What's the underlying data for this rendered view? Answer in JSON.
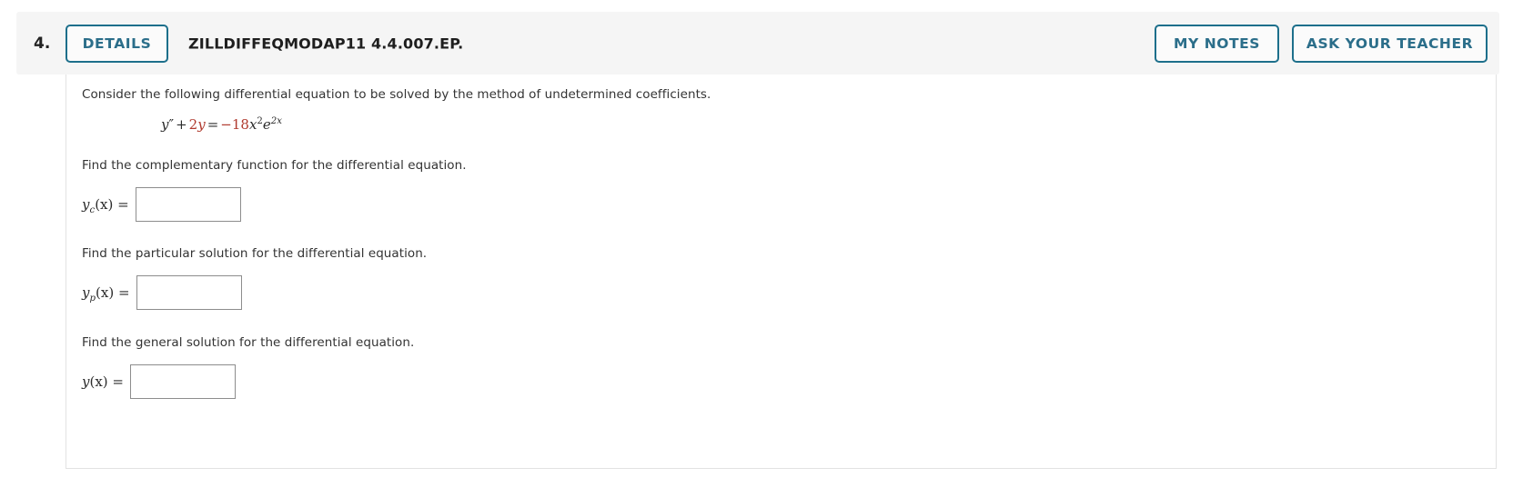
{
  "header": {
    "question_number": "4.",
    "details_label": "DETAILS",
    "assignment_id": "ZILLDIFFEQMODAP11 4.4.007.EP.",
    "my_notes_label": "MY NOTES",
    "ask_teacher_label": "ASK YOUR TEACHER",
    "accent_color": "#1d6f8b",
    "bar_background": "#f5f5f5"
  },
  "body": {
    "intro_text": "Consider the following differential equation to be solved by the method of undetermined coefficients.",
    "equation": {
      "lhs_y": "y",
      "lhs_primes": "″",
      "plus": "+",
      "coef_2": "2",
      "var_y": "y",
      "equals": "=",
      "minus": "−",
      "coef_18": "18",
      "var_x": "x",
      "exp_2": "2",
      "e": "e",
      "exp_2x": "2x",
      "highlight_color": "#b03a2e"
    },
    "sections": [
      {
        "prompt": "Find the complementary function for the differential equation.",
        "label_fn": "y",
        "label_sub": "c",
        "label_tail": "(x) =",
        "input_value": "",
        "input_placeholder": ""
      },
      {
        "prompt": "Find the particular solution for the differential equation.",
        "label_fn": "y",
        "label_sub": "p",
        "label_tail": "(x) =",
        "input_value": "",
        "input_placeholder": ""
      },
      {
        "prompt": "Find the general solution for the differential equation.",
        "label_fn": "y",
        "label_sub": "",
        "label_tail": "(x) =",
        "input_value": "",
        "input_placeholder": ""
      }
    ]
  }
}
